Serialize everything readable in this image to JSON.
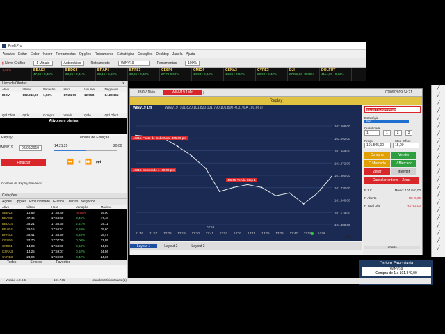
{
  "app": {
    "title": "ProfitPro"
  },
  "menu": [
    "Arquivo",
    "Editar",
    "Exibir",
    "Inserir",
    "Ferramentas",
    "Opções",
    "Roteamento",
    "Estratégias",
    "Cotações",
    "Desktop",
    "Janela",
    "Ajuda"
  ],
  "toolbar": {
    "new_chart": "Novo Gráfico",
    "interval": "1 Minuto",
    "auto": "Automático",
    "routing": "Roteamento",
    "asset": "WINV19",
    "tools": "Ferramentas",
    "pct": "100%"
  },
  "ticker": [
    {
      "s": "",
      "v": "-0,58%",
      "c": "neg"
    },
    {
      "s": "BBAS3",
      "v": "47,46 +3,45%",
      "c": "pos"
    },
    {
      "s": "BBDC4",
      "v": "33,21 +2,31%",
      "c": "pos"
    },
    {
      "s": "BRAP4",
      "v": "29,15 +8,69%",
      "c": "pos"
    },
    {
      "s": "BRFS3",
      "v": "38,41 +3,33%",
      "c": "pos"
    },
    {
      "s": "CESP6",
      "v": "27,70 0,00%",
      "c": "pos"
    },
    {
      "s": "CMIG4",
      "v": "14,93 +0,34%",
      "c": "pos"
    },
    {
      "s": "CSNA3",
      "v": "14,25 +0,92%",
      "c": "pos"
    },
    {
      "s": "CYRE3",
      "v": "23,90 +0,42%",
      "c": "pos"
    },
    {
      "s": "DJI",
      "v": "27332,03 +0,98%",
      "c": "pos"
    },
    {
      "s": "DOLFUT",
      "v": "4114,00 +0,32%",
      "c": "pos"
    }
  ],
  "book": {
    "title": "Livro de Ofertas",
    "cols": [
      "Ativo",
      "Último",
      "Variação",
      "Hora",
      "Volume",
      "Negócios"
    ],
    "row": [
      "IBOV",
      "102.243,00",
      "1,03%",
      "17:24:00",
      "12,95B",
      "1.123.162"
    ],
    "sub": [
      "Qtd Ofert.",
      "Qtde",
      "Compra",
      "Venda",
      "Qtde",
      "Qtd Ofert."
    ],
    "empty": "Ativo sem ofertas"
  },
  "replay": {
    "label": "Replay",
    "mode": "Modos de Exibição",
    "asset": "WINV19",
    "date": "02/09/2019",
    "time": "14:21:29",
    "speed": "20:00",
    "finish": "Finalizar",
    "ctrl": "Controle da Replay Salvando"
  },
  "quotes": {
    "title": "Cotações",
    "tabs": [
      "Ações",
      "Opções",
      "Profundidade",
      "Gráfico",
      "Ofertas",
      "Negócios"
    ],
    "cols": [
      "Ativo",
      "Último",
      "Hora",
      "Variação",
      "Máximo"
    ],
    "rows": [
      [
        "ABEV3",
        "18,69",
        "17:58:49",
        "-0,59%",
        "19,00"
      ],
      [
        "BBAS3",
        "47,46",
        "17:58:40",
        "3,45%",
        "47,48"
      ],
      [
        "BBDC4",
        "33,21",
        "17:58:35",
        "2,31%",
        "34,11"
      ],
      [
        "BRAP4",
        "29,15",
        "17:56:51",
        "8,69%",
        "29,60"
      ],
      [
        "BRFS3",
        "38,41",
        "17:58:59",
        "3,33%",
        "38,47"
      ],
      [
        "CESP6",
        "27,70",
        "17:07:00",
        "0,00%",
        "27,95"
      ],
      [
        "CMIG4",
        "14,93",
        "17:58:49",
        "0,34%",
        "14,93"
      ],
      [
        "CSNA3",
        "14,25",
        "17:59:07",
        "0,92%",
        "14,56"
      ],
      [
        "CYRE3",
        "23,90",
        "17:59:00",
        "0,42%",
        "24,36"
      ]
    ],
    "bottom_tabs": [
      "Todos",
      "Setores",
      "Favoritos"
    ]
  },
  "chart_window": {
    "tabs": [
      "IBOV 1Min",
      "WINV19 1Min"
    ],
    "date": "02/09/2019 14:21",
    "replay": "Replay",
    "info": "WINV19 (101.820  101.820  101.790  101.800  -0,01%  A 101.667)",
    "symbol": "WINV19 1m",
    "ylabels": [
      "102.208,00",
      "102.092,00",
      "101.944,00",
      "101.872,00",
      "101.800,00",
      "101.730,00",
      "101.648,00",
      "101.574,00",
      "101.488,00"
    ],
    "xlabels": [
      "11:46",
      "11:57",
      "12:08",
      "12:19",
      "12:30",
      "12:41",
      "12:52",
      "13:03",
      "13:14",
      "13:25",
      "13:36",
      "13:47",
      "13:58",
      "14:09"
    ],
    "markers": {
      "cob": "48215  Ponto de Cobertura  -405,00 pts",
      "buy": "48215  Comprado 1  -40,00 pts",
      "stop": "48215  Venda Stop 1"
    },
    "layouts": [
      "Layout 1",
      "Layout 2",
      "Layout 3"
    ],
    "xaxis_end": "02:58",
    "zoom": "35s"
  },
  "order_panel": {
    "account": "48215 | SUMARA BR",
    "strategy_label": "Estratégia",
    "strategy": "Sen",
    "qty_label": "Quantidade",
    "qty": "1",
    "btns": [
      "1",
      "2",
      "3"
    ],
    "price_label": "Preço",
    "price": "101.545,00",
    "stop_label": "Stop Offset",
    "stop": "15,00",
    "buy": "Comprar",
    "sell": "Vender",
    "cbuy": "C Mercado",
    "csell": "V Mercado",
    "zero": "Zerar",
    "invert": "Inverter",
    "cancel": "Cancelar ordens + Zerar",
    "pos": "P  1 C",
    "avg": "Médio: 101.840,00",
    "ra_label": "R Aberto",
    "ra": "R$ -5,00",
    "rt_label": "R Total Dia",
    "rt": "R$ -82,00",
    "status": "Aberta"
  },
  "toast": {
    "title": "Ordem Executada",
    "line1": "WINV19",
    "line2": "Compra de 1 a 101.840,00"
  },
  "status": {
    "version": "Versão 4.2.0.5",
    "value": "101.746",
    "windows": "Janelas Minimizadas (1)"
  },
  "chart_data": {
    "type": "line",
    "x": [
      "11:46",
      "11:57",
      "12:08",
      "12:19",
      "12:30",
      "12:41",
      "12:52",
      "13:03",
      "13:14",
      "13:25",
      "13:36",
      "13:47",
      "13:58",
      "14:09",
      "14:21"
    ],
    "values": [
      102140,
      102130,
      102120,
      102060,
      101990,
      101900,
      101730,
      101760,
      101780,
      101760,
      101700,
      101720,
      101640,
      101720,
      101840
    ],
    "ylim": [
      101488,
      102208
    ]
  }
}
